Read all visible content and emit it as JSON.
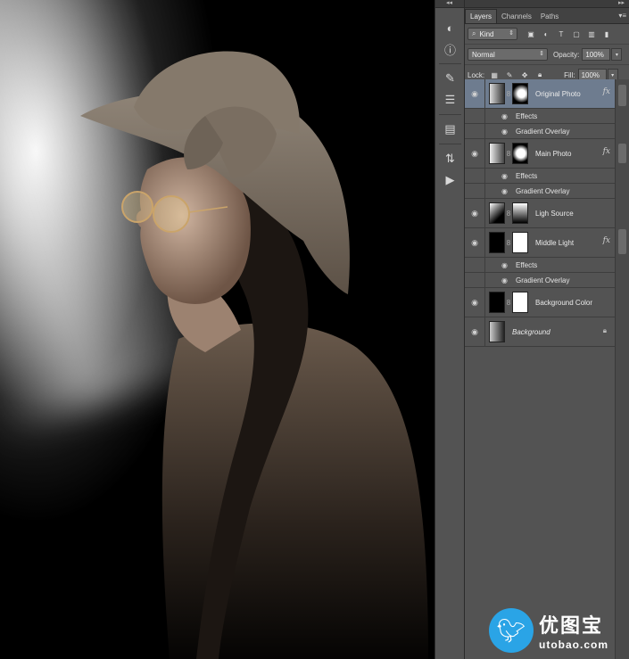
{
  "panel": {
    "tabs": [
      "Layers",
      "Channels",
      "Paths"
    ],
    "filter_kind": "Kind",
    "blend_mode": "Normal",
    "opacity_label": "Opacity:",
    "opacity_value": "100%",
    "lock_label": "Lock:",
    "fill_label": "Fill:",
    "fill_value": "100%"
  },
  "layers": [
    {
      "name": "Original Photo",
      "selected": true,
      "fx": true,
      "effects_label": "Effects",
      "effect": "Gradient Overlay"
    },
    {
      "name": "Main Photo",
      "fx": true,
      "effects_label": "Effects",
      "effect": "Gradient Overlay"
    },
    {
      "name": "Ligh Source"
    },
    {
      "name": "Middle Light",
      "fx": true,
      "effects_label": "Effects",
      "effect": "Gradient Overlay"
    },
    {
      "name": "Background Color"
    },
    {
      "name": "Background",
      "locked": true
    }
  ],
  "fx_symbol": "fx",
  "watermark": {
    "title": "优图宝",
    "url": "utobao.com"
  },
  "colors": {
    "panel_bg": "#535353",
    "selected_layer": "#6e7c8f",
    "watermark_blue": "#2aa4e6"
  }
}
